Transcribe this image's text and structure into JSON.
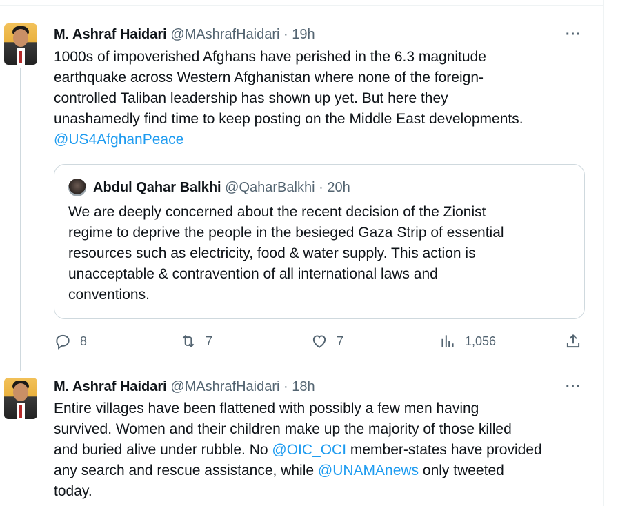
{
  "tweets": [
    {
      "name": "M. Ashraf Haidari",
      "handle": "@MAshrafHaidari",
      "separator": "·",
      "time": "19h",
      "more": "···",
      "text_lines": [
        "1000s of impoverished Afghans have perished in the 6.3 magnitude",
        "earthquake across Western Afghanistan where none of the foreign-",
        "controlled Taliban leadership has shown up yet. But here they",
        "unashamedly find time to keep posting on the Middle East developments."
      ],
      "mention": "@US4AfghanPeace",
      "quote": {
        "name": "Abdul Qahar Balkhi",
        "handle": "@QaharBalkhi",
        "separator": "·",
        "time": "20h",
        "text_lines": [
          "We are deeply concerned about the recent decision of the Zionist",
          "regime to deprive the people in the besieged Gaza Strip of essential",
          "resources such as electricity, food & water supply. This action is",
          "unacceptable & contravention of all international laws and",
          "conventions."
        ]
      },
      "actions": {
        "replies": "8",
        "retweets": "7",
        "likes": "7",
        "views": "1,056"
      }
    },
    {
      "name": "M. Ashraf Haidari",
      "handle": "@MAshrafHaidari",
      "separator": "·",
      "time": "18h",
      "more": "···",
      "line1": "Entire villages have been flattened with possibly a few men having",
      "line2": "survived. Women and their children make up the majority of those killed",
      "line3_pre": "and buried alive under rubble. No ",
      "line3_mention": "@OIC_OCI",
      "line3_post": " member-states have provided",
      "line4_pre": "any search and rescue assistance, while ",
      "line4_mention": "@UNAMAnews",
      "line4_post": " only tweeted",
      "line5": "today."
    }
  ],
  "icons": {
    "reply": "reply-icon",
    "retweet": "retweet-icon",
    "like": "heart-icon",
    "views": "analytics-icon",
    "share": "share-icon"
  },
  "colors": {
    "link": "#1d9bf0",
    "muted": "#536471",
    "border": "#cfd9de"
  }
}
